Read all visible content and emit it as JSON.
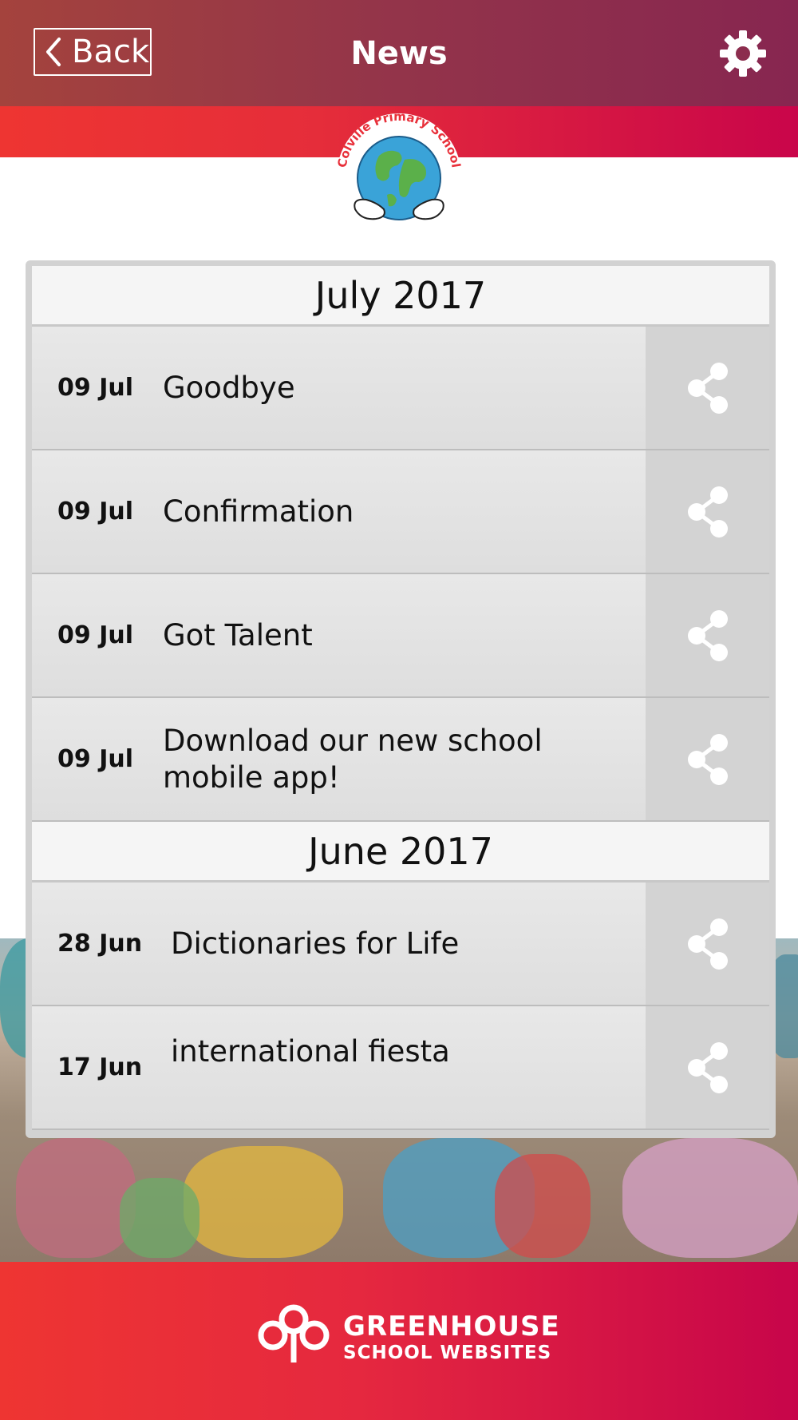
{
  "header": {
    "back_label": "Back",
    "title": "News"
  },
  "logo": {
    "school_name": "Colville Primary School"
  },
  "news": {
    "groups": [
      {
        "month": "July 2017",
        "items": [
          {
            "date": "09 Jul",
            "title": "Goodbye"
          },
          {
            "date": "09 Jul",
            "title": "Confirmation"
          },
          {
            "date": "09 Jul",
            "title": "Got Talent"
          },
          {
            "date": "09 Jul",
            "title": "Download our new school mobile app!"
          }
        ]
      },
      {
        "month": "June 2017",
        "items": [
          {
            "date": "28 Jun",
            "title": "Dictionaries for Life"
          },
          {
            "date": "17 Jun",
            "title": "international fiesta"
          }
        ]
      }
    ]
  },
  "footer": {
    "brand_line1": "GREENHOUSE",
    "brand_line2": "SCHOOL WEBSITES"
  },
  "icons": {
    "back": "chevron-left-icon",
    "settings": "gear-icon",
    "share": "share-icon",
    "footer_logo": "greenhouse-logo-icon"
  },
  "colors": {
    "header": "#93344a",
    "accent_red": "#ee3532",
    "accent_magenta": "#c9054a",
    "card": "#d2d2d2"
  }
}
